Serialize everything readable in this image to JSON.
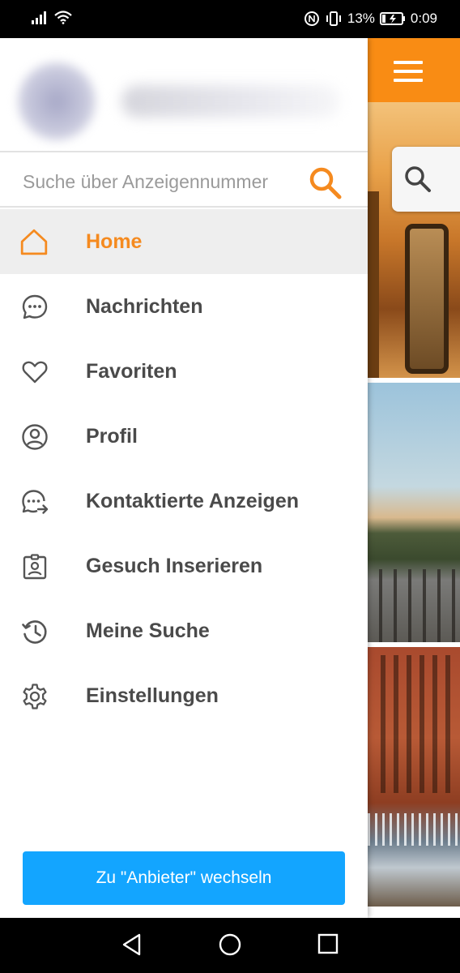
{
  "status_bar": {
    "battery_percent": "13%",
    "time": "0:09"
  },
  "drawer": {
    "search": {
      "placeholder": "Suche über Anzeigennummer",
      "value": ""
    },
    "menu": [
      {
        "label": "Home",
        "icon": "home-icon",
        "active": true
      },
      {
        "label": "Nachrichten",
        "icon": "chat-bubble-icon",
        "active": false
      },
      {
        "label": "Favoriten",
        "icon": "heart-icon",
        "active": false
      },
      {
        "label": "Profil",
        "icon": "user-circle-icon",
        "active": false
      },
      {
        "label": "Kontaktierte Anzeigen",
        "icon": "chat-forward-icon",
        "active": false
      },
      {
        "label": "Gesuch Inserieren",
        "icon": "id-badge-icon",
        "active": false
      },
      {
        "label": "Meine Suche",
        "icon": "history-icon",
        "active": false
      },
      {
        "label": "Einstellungen",
        "icon": "gear-icon",
        "active": false
      }
    ],
    "switch_button": "Zu \"Anbieter\" wechseln"
  },
  "colors": {
    "accent": "#f58a1f",
    "header_orange": "#f98c14",
    "button_blue": "#13a5ff",
    "text": "#4a4a4a"
  }
}
